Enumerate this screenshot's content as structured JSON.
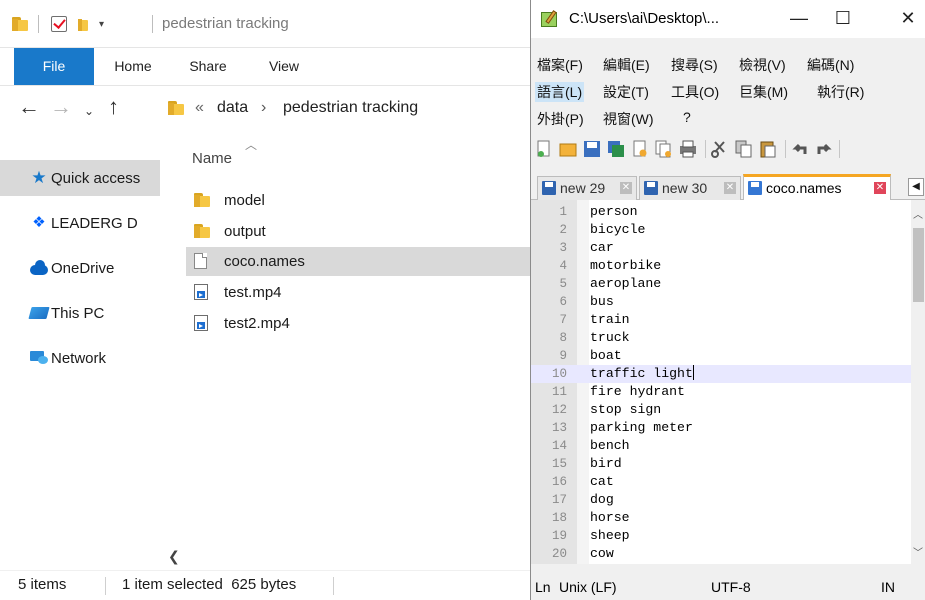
{
  "explorer": {
    "title": "pedestrian tracking",
    "ribbon_tabs": [
      "File",
      "Home",
      "Share",
      "View"
    ],
    "address": {
      "overflow": "«",
      "crumbs": [
        "data",
        "pedestrian tracking"
      ],
      "separator": "›"
    },
    "column_header": "Name",
    "nav_items": [
      {
        "label": "Quick access",
        "icon": "star-icon"
      },
      {
        "label": "LEADERG D",
        "icon": "dropbox-icon"
      },
      {
        "label": "OneDrive",
        "icon": "onedrive-cloud-icon"
      },
      {
        "label": "This PC",
        "icon": "pc-icon"
      },
      {
        "label": "Network",
        "icon": "network-icon"
      }
    ],
    "files": [
      {
        "name": "model",
        "type": "folder"
      },
      {
        "name": "output",
        "type": "folder"
      },
      {
        "name": "coco.names",
        "type": "file",
        "selected": true
      },
      {
        "name": "test.mp4",
        "type": "video"
      },
      {
        "name": "test2.mp4",
        "type": "video"
      }
    ],
    "status": {
      "items": "5 items",
      "selection": "1 item selected  625 bytes"
    }
  },
  "notepad": {
    "title": "C:\\Users\\ai\\Desktop\\...",
    "window_buttons": {
      "minimize": "—",
      "maximize": "☐",
      "close": "✕"
    },
    "menu_rows": [
      [
        "檔案(F)",
        "編輯(E)",
        "搜尋(S)",
        "檢視(V)",
        "編碼(N)"
      ],
      [
        "語言(L)",
        "設定(T)",
        "工具(O)",
        "巨集(M)",
        "執行(R)"
      ],
      [
        "外掛(P)",
        "視窗(W)",
        "?"
      ]
    ],
    "tabs": [
      {
        "label": "new 29",
        "active": false
      },
      {
        "label": "new 30",
        "active": false
      },
      {
        "label": "coco.names",
        "active": true
      }
    ],
    "lines": [
      "person",
      "bicycle",
      "car",
      "motorbike",
      "aeroplane",
      "bus",
      "train",
      "truck",
      "boat",
      "traffic light",
      "fire hydrant",
      "stop sign",
      "parking meter",
      "bench",
      "bird",
      "cat",
      "dog",
      "horse",
      "sheep",
      "cow"
    ],
    "current_line": 10,
    "status": {
      "ln": "Ln",
      "eol": "Unix (LF)",
      "encoding": "UTF-8",
      "mode": "IN"
    }
  }
}
